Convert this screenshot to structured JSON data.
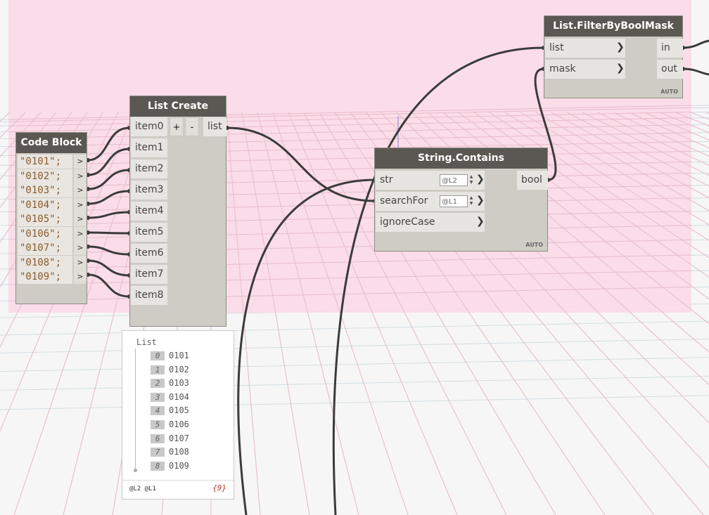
{
  "colors": {
    "background_zone": "#fbd9e6",
    "grid_line": "#d6e0e6",
    "node_header": "#5b5753",
    "node_body": "#cfccc6",
    "wire": "#3b3b3b"
  },
  "code_block": {
    "title": "Code Block",
    "lines": [
      "\"0101\";",
      "\"0102\";",
      "\"0103\";",
      "\"0104\";",
      "\"0105\";",
      "\"0106\";",
      "\"0107\";",
      "\"0108\";",
      "\"0109\";"
    ],
    "output_glyph": ">"
  },
  "list_create": {
    "title": "List Create",
    "inputs": [
      "item0",
      "item1",
      "item2",
      "item3",
      "item4",
      "item5",
      "item6",
      "item7",
      "item8"
    ],
    "add_label": "+",
    "remove_label": "-",
    "output": "list"
  },
  "string_contains": {
    "title": "String.Contains",
    "inputs": [
      {
        "label": "str",
        "lacing": "@L2"
      },
      {
        "label": "searchFor",
        "lacing": "@L1"
      },
      {
        "label": "ignoreCase",
        "lacing": ""
      }
    ],
    "output": "bool",
    "auto": "AUTO"
  },
  "filter_mask": {
    "title": "List.FilterByBoolMask",
    "inputs": [
      "list",
      "mask"
    ],
    "outputs": [
      "in",
      "out"
    ],
    "auto": "AUTO"
  },
  "preview": {
    "header": "List",
    "items": [
      {
        "index": "0",
        "value": "0101"
      },
      {
        "index": "1",
        "value": "0102"
      },
      {
        "index": "2",
        "value": "0103"
      },
      {
        "index": "3",
        "value": "0104"
      },
      {
        "index": "4",
        "value": "0105"
      },
      {
        "index": "5",
        "value": "0106"
      },
      {
        "index": "6",
        "value": "0107"
      },
      {
        "index": "7",
        "value": "0108"
      },
      {
        "index": "8",
        "value": "0109"
      }
    ],
    "footer_levels": "@L2 @L1",
    "footer_count": "{9}"
  }
}
